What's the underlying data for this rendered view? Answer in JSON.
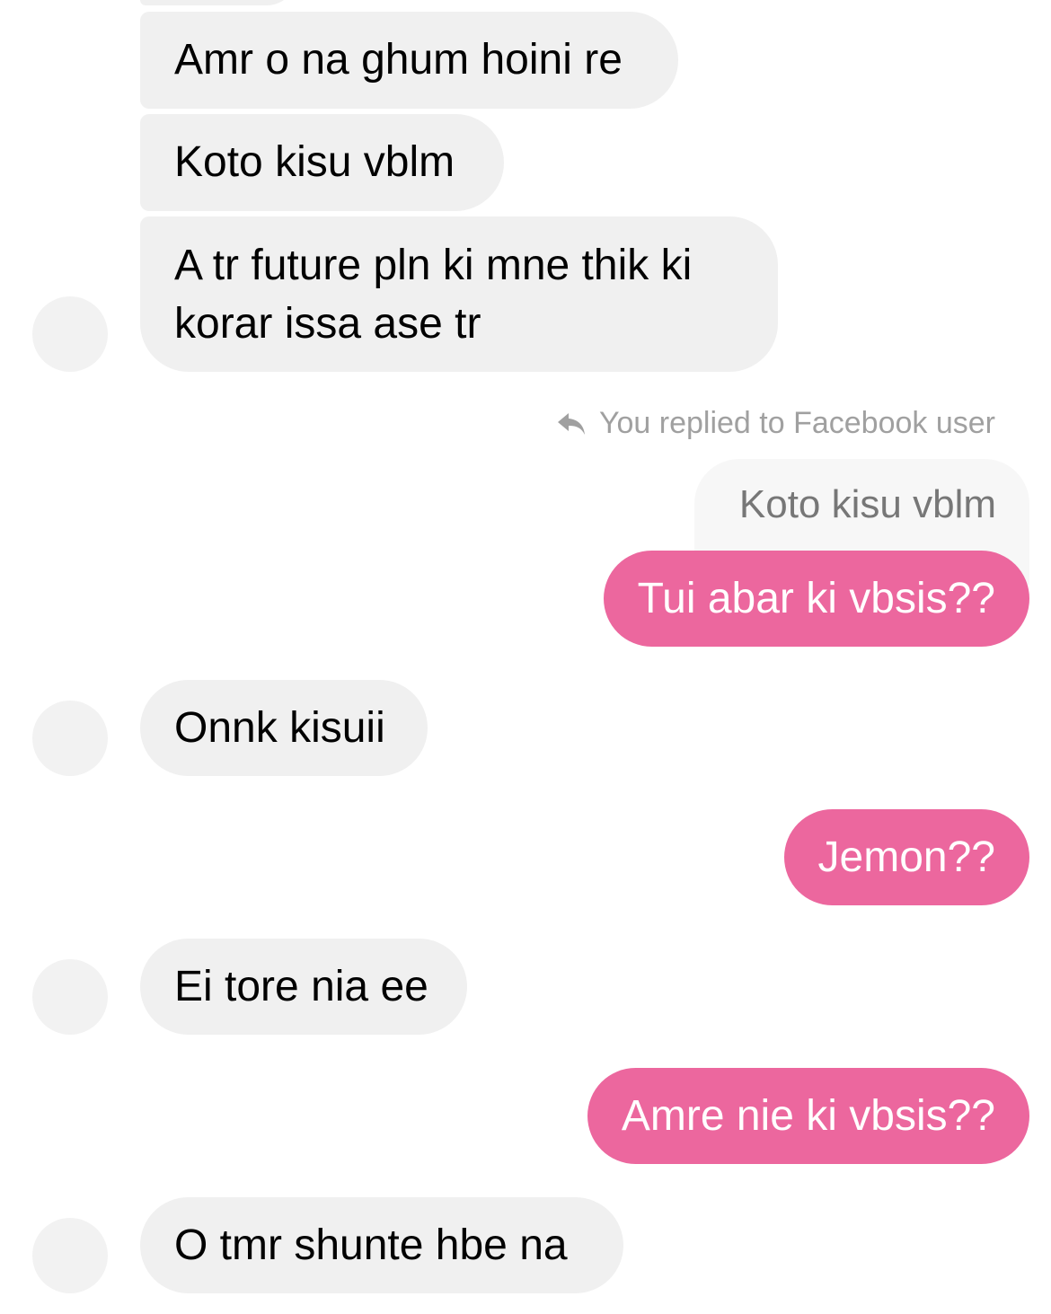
{
  "colors": {
    "outgoing": "#ec679e",
    "incoming": "#f0f0f0",
    "quoted": "#f7f7f7"
  },
  "messages": [
    {
      "text": "Amr o na ghum hoini re"
    },
    {
      "text": "Koto kisu vblm"
    },
    {
      "text": "A tr future pln ki mne thik ki korar issa ase tr"
    },
    {
      "text": "Tui abar ki vbsis??"
    },
    {
      "text": "Onnk kisuii"
    },
    {
      "text": "Jemon??"
    },
    {
      "text": "Ei tore nia ee"
    },
    {
      "text": "Amre nie ki vbsis??"
    },
    {
      "text": "O tmr shunte hbe na"
    }
  ],
  "reply": {
    "icon": "reply-arrow-icon",
    "label": "You replied to Facebook user",
    "quoted_text": "Koto kisu vblm"
  }
}
